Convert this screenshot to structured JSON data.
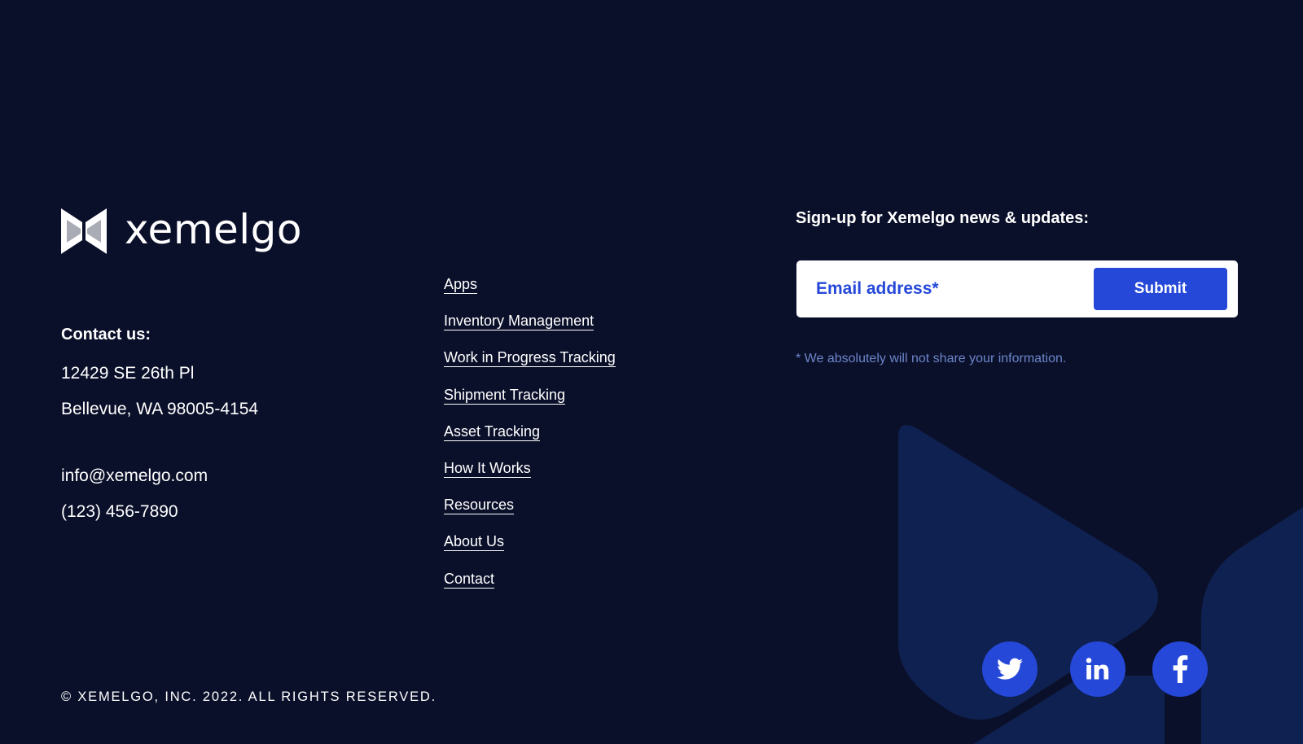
{
  "brand": {
    "name": "xemelgo",
    "logo_icon": "xemelgo-x-logo-icon"
  },
  "contact": {
    "heading": "Contact us:",
    "address_line1": "12429 SE 26th Pl",
    "address_line2": "Bellevue, WA 98005-4154",
    "email": "info@xemelgo.com",
    "phone": "(123) 456-7890"
  },
  "nav": {
    "items": [
      {
        "label": "Apps"
      },
      {
        "label": "Inventory Management"
      },
      {
        "label": "Work in Progress Tracking"
      },
      {
        "label": "Shipment Tracking"
      },
      {
        "label": "Asset Tracking"
      },
      {
        "label": "How It Works"
      },
      {
        "label": "Resources"
      },
      {
        "label": "About Us"
      },
      {
        "label": "Contact"
      }
    ]
  },
  "signup": {
    "title": "Sign-up for Xemelgo news & updates:",
    "email_placeholder": "Email address*",
    "email_value": "",
    "submit_label": "Submit",
    "disclaimer": "* We absolutely will not share your information."
  },
  "social": [
    {
      "name": "twitter",
      "icon": "twitter-icon"
    },
    {
      "name": "linkedin",
      "icon": "linkedin-icon"
    },
    {
      "name": "facebook",
      "icon": "facebook-icon"
    }
  ],
  "footer": {
    "copyright": "© XEMELGO, INC. 2022. ALL RIGHTS RESERVED."
  },
  "colors": {
    "background": "#0b102a",
    "accent": "#2548d9",
    "muted_text": "#6b85c9",
    "shape": "#0f2150"
  }
}
